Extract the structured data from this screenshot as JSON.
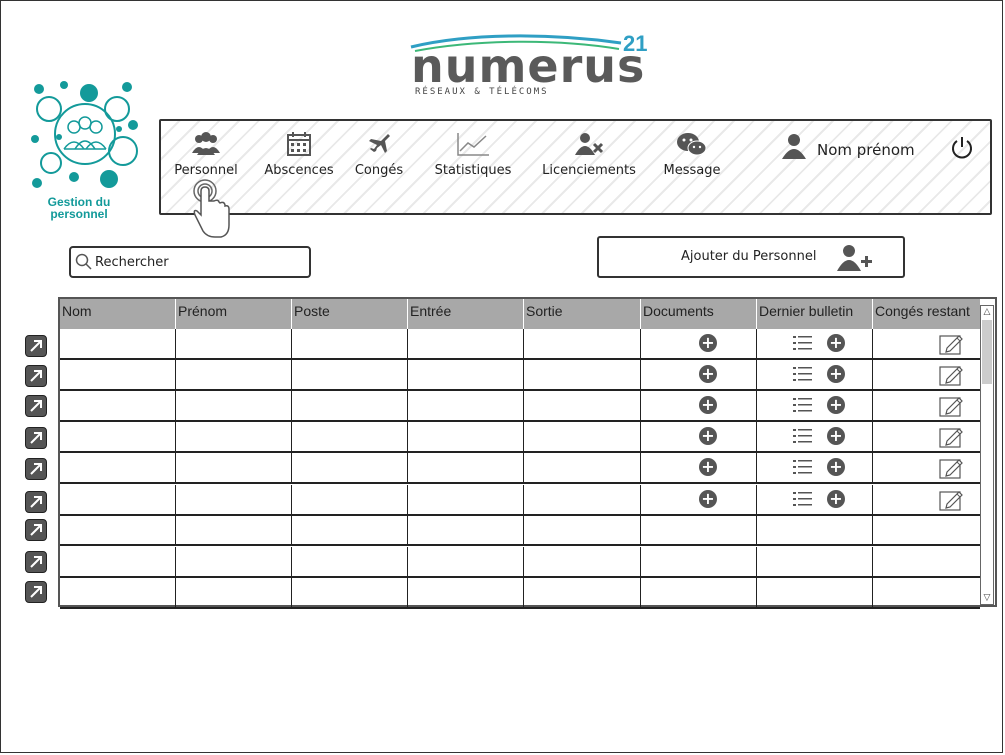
{
  "header": {
    "logo_text": "numerus",
    "logo_superscript": "21",
    "logo_tagline": "RÉSEAUX & TÉLÉCOMS"
  },
  "brand": {
    "label_line1": "Gestion du",
    "label_line2": "personnel",
    "accent_color": "#139a9a"
  },
  "nav": {
    "items": [
      {
        "label": "Personnel",
        "icon": "users-icon",
        "active": true
      },
      {
        "label": "Abscences",
        "icon": "calendar-icon"
      },
      {
        "label": "Congés",
        "icon": "airplane-icon"
      },
      {
        "label": "Statistiques",
        "icon": "line-chart-icon"
      },
      {
        "label": "Licenciements",
        "icon": "user-remove-icon"
      },
      {
        "label": "Message",
        "icon": "chat-icon"
      }
    ],
    "user_name": "Nom prénom",
    "logout_icon": "power-icon"
  },
  "search": {
    "placeholder": "Rechercher"
  },
  "actions": {
    "add_staff_label": "Ajouter du Personnel"
  },
  "table": {
    "columns": [
      "Nom",
      "Prénom",
      "Poste",
      "Entrée",
      "Sortie",
      "Documents",
      "Dernier bulletin",
      "Congés restant"
    ],
    "rows": [
      {
        "nom": "",
        "prenom": "",
        "poste": "",
        "entree": "",
        "sortie": "",
        "has_actions": true
      },
      {
        "nom": "",
        "prenom": "",
        "poste": "",
        "entree": "",
        "sortie": "",
        "has_actions": true
      },
      {
        "nom": "",
        "prenom": "",
        "poste": "",
        "entree": "",
        "sortie": "",
        "has_actions": true
      },
      {
        "nom": "",
        "prenom": "",
        "poste": "",
        "entree": "",
        "sortie": "",
        "has_actions": true
      },
      {
        "nom": "",
        "prenom": "",
        "poste": "",
        "entree": "",
        "sortie": "",
        "has_actions": true
      },
      {
        "nom": "",
        "prenom": "",
        "poste": "",
        "entree": "",
        "sortie": "",
        "has_actions": true
      },
      {
        "nom": "",
        "prenom": "",
        "poste": "",
        "entree": "",
        "sortie": "",
        "has_actions": false
      },
      {
        "nom": "",
        "prenom": "",
        "poste": "",
        "entree": "",
        "sortie": "",
        "has_actions": false
      },
      {
        "nom": "",
        "prenom": "",
        "poste": "",
        "entree": "",
        "sortie": "",
        "has_actions": false
      }
    ],
    "header_color": "#a8a8a8"
  }
}
